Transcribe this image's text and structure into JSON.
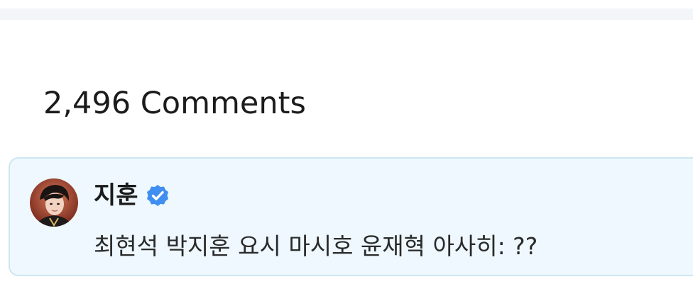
{
  "comments_section": {
    "count_label": "2,496 Comments"
  },
  "pinned_comment": {
    "author": "지훈",
    "verified": true,
    "avatar_icon": "profile-photo",
    "text": "최현석 박지훈 요시 마시호 윤재혁 아사히: ??"
  },
  "colors": {
    "card_background": "#eef8fe",
    "card_border": "#cfe6f2",
    "verified_badge": "#3f8ef0",
    "top_strip": "#f4f5f8"
  }
}
